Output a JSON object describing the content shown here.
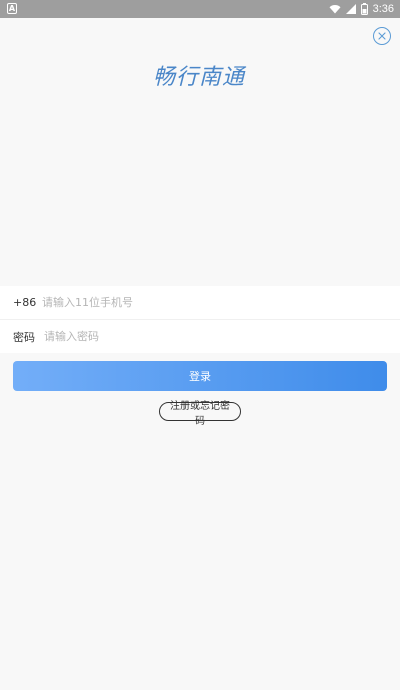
{
  "status_bar": {
    "time": "3:36",
    "left_icon": "A",
    "icons": [
      "wifi-icon",
      "signal-icon",
      "battery-icon"
    ]
  },
  "close_icon": "close-icon",
  "logo_text": "畅行南通",
  "phone": {
    "prefix": "+86",
    "placeholder": "请输入11位手机号",
    "value": ""
  },
  "password": {
    "label": "密码",
    "placeholder": "请输入密码",
    "value": ""
  },
  "login_label": "登录",
  "register_label": "注册或忘记密码",
  "colors": {
    "accent": "#3f8cea",
    "accent_light": "#73aef8",
    "status_bar": "#9e9e9e",
    "background": "#f8f8f8"
  }
}
